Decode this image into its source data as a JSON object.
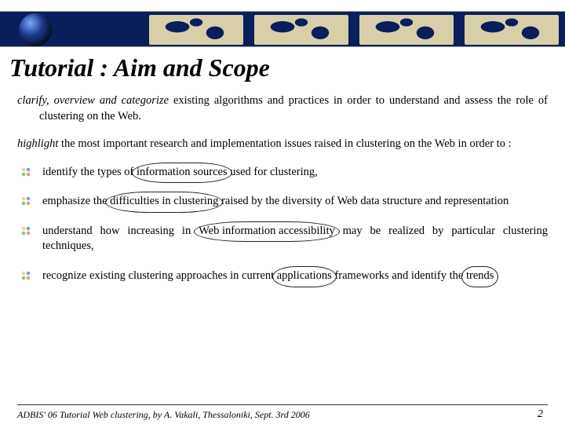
{
  "title": "Tutorial : Aim and Scope",
  "para1": {
    "lead": "clarify, overview and categorize",
    "rest": " existing algorithms and practices in order to understand and assess the role of clustering on the Web."
  },
  "para2": {
    "lead": "highlight",
    "rest": " the most important research and implementation issues raised in clustering on the Web in order to :"
  },
  "bullets": [
    {
      "pre": "identify the types of ",
      "circ": "information sources",
      "post": " used for clustering,"
    },
    {
      "pre": "emphasize  the ",
      "circ": "difficulties in clustering",
      "post": " raised by the diversity of Web data structure and representation"
    },
    {
      "pre": "understand how increasing in ",
      "circ": "Web information accessibility",
      "post": " may be realized by particular clustering techniques,"
    },
    {
      "pre": "recognize existing clustering approaches in current ",
      "circ": "applications",
      "post": " frameworks and identify the ",
      "circ2": "trends",
      "post2": ""
    }
  ],
  "footer": {
    "source": "ADBIS' 06 Tutorial Web clustering, by A. Vakali, Thessaloniki, Sept. 3rd  2006",
    "page": "2"
  }
}
